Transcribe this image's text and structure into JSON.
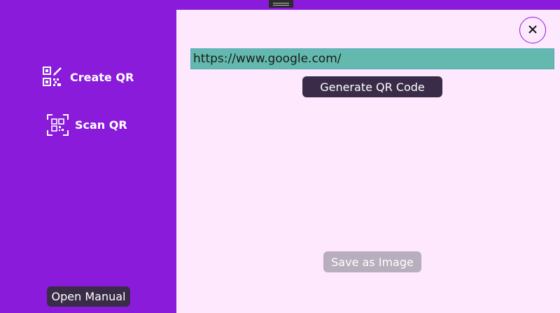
{
  "sidebar": {
    "items": [
      {
        "label": "Create QR",
        "icon": "qr-create-icon"
      },
      {
        "label": "Scan QR",
        "icon": "qr-scan-icon"
      }
    ],
    "manual_label": "Open Manual"
  },
  "main": {
    "url_value": "https://www.google.com/",
    "generate_label": "Generate QR Code",
    "save_label": "Save as Image",
    "close_icon": "close-icon"
  },
  "colors": {
    "sidebar_bg": "#8a1bdb",
    "content_bg": "#fde8fd",
    "button_dark": "#3a2c49",
    "button_disabled": "#b8aebd",
    "input_bg": "#63b9ad"
  }
}
